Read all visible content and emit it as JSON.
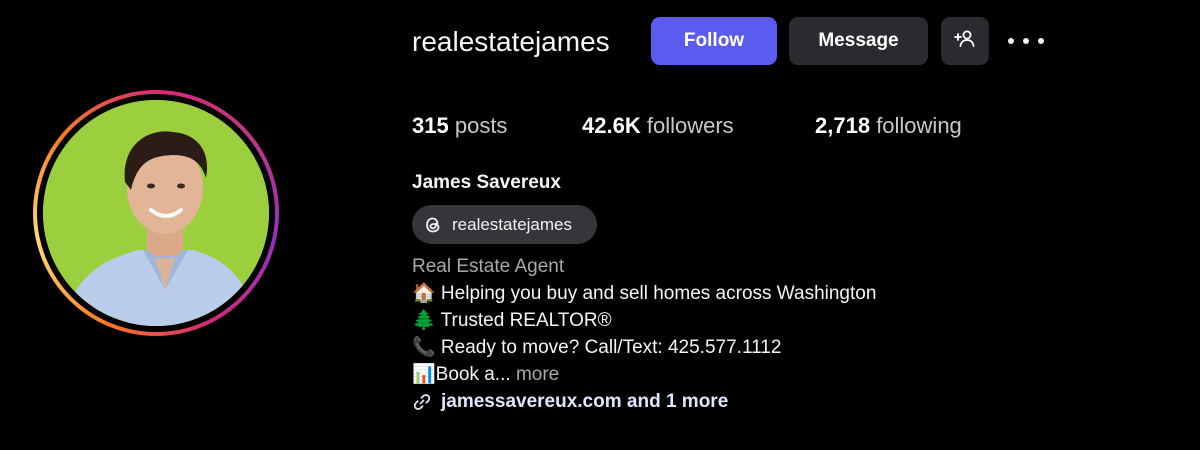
{
  "profile": {
    "username": "realestatejames",
    "full_name": "James Savereux",
    "threads_handle": "realestatejames",
    "category": "Real Estate Agent"
  },
  "actions": {
    "follow_label": "Follow",
    "message_label": "Message",
    "follow_color": "#5b5bf0",
    "secondary_color": "#2a2b2f"
  },
  "stats": {
    "posts_count": "315",
    "posts_label": "posts",
    "followers_count": "42.6K",
    "followers_label": "followers",
    "following_count": "2,718",
    "following_label": "following"
  },
  "bio": {
    "line1": "🏠 Helping you buy and sell homes across Washington",
    "line2": "🌲 Trusted REALTOR®",
    "line3": "📞 Ready to move? Call/Text: 425.577.1112",
    "line4": "📊Book a...",
    "more_label": "more",
    "link_text": "jamessavereux.com and 1 more"
  },
  "icons": {
    "add_user": "add-user-icon",
    "more": "more-options-icon",
    "threads": "threads-icon",
    "link": "link-icon"
  }
}
